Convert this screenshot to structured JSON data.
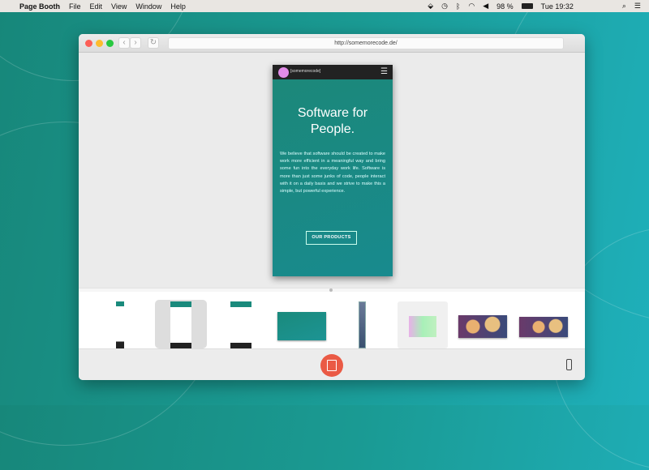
{
  "menubar": {
    "app_name": "Page Booth",
    "menus": [
      "File",
      "Edit",
      "View",
      "Window",
      "Help"
    ],
    "battery": "98 %",
    "clock": "Tue 19:32"
  },
  "browser": {
    "url": "http://somemorecode.de/"
  },
  "preview": {
    "brand": "[somemorecode]",
    "headline": "Software for People.",
    "body": "We believe that software should be created to make work more efficient in a meaningful way and bring some fun into the everyday work life. Software is more than just some junks of code, people interact with it on a daily basis and we strive to make this a simple, but powerful experience.",
    "cta": "OUR PRODUCTS"
  },
  "thumbnails": [
    {
      "kind": "narrow-phone",
      "selected": false
    },
    {
      "kind": "phone",
      "selected": true
    },
    {
      "kind": "phone",
      "selected": false
    },
    {
      "kind": "desktop-teal",
      "selected": false
    },
    {
      "kind": "tall-strip",
      "selected": false
    },
    {
      "kind": "tablet",
      "selected": false
    },
    {
      "kind": "bokeh",
      "selected": false
    },
    {
      "kind": "bokeh",
      "selected": false
    }
  ]
}
